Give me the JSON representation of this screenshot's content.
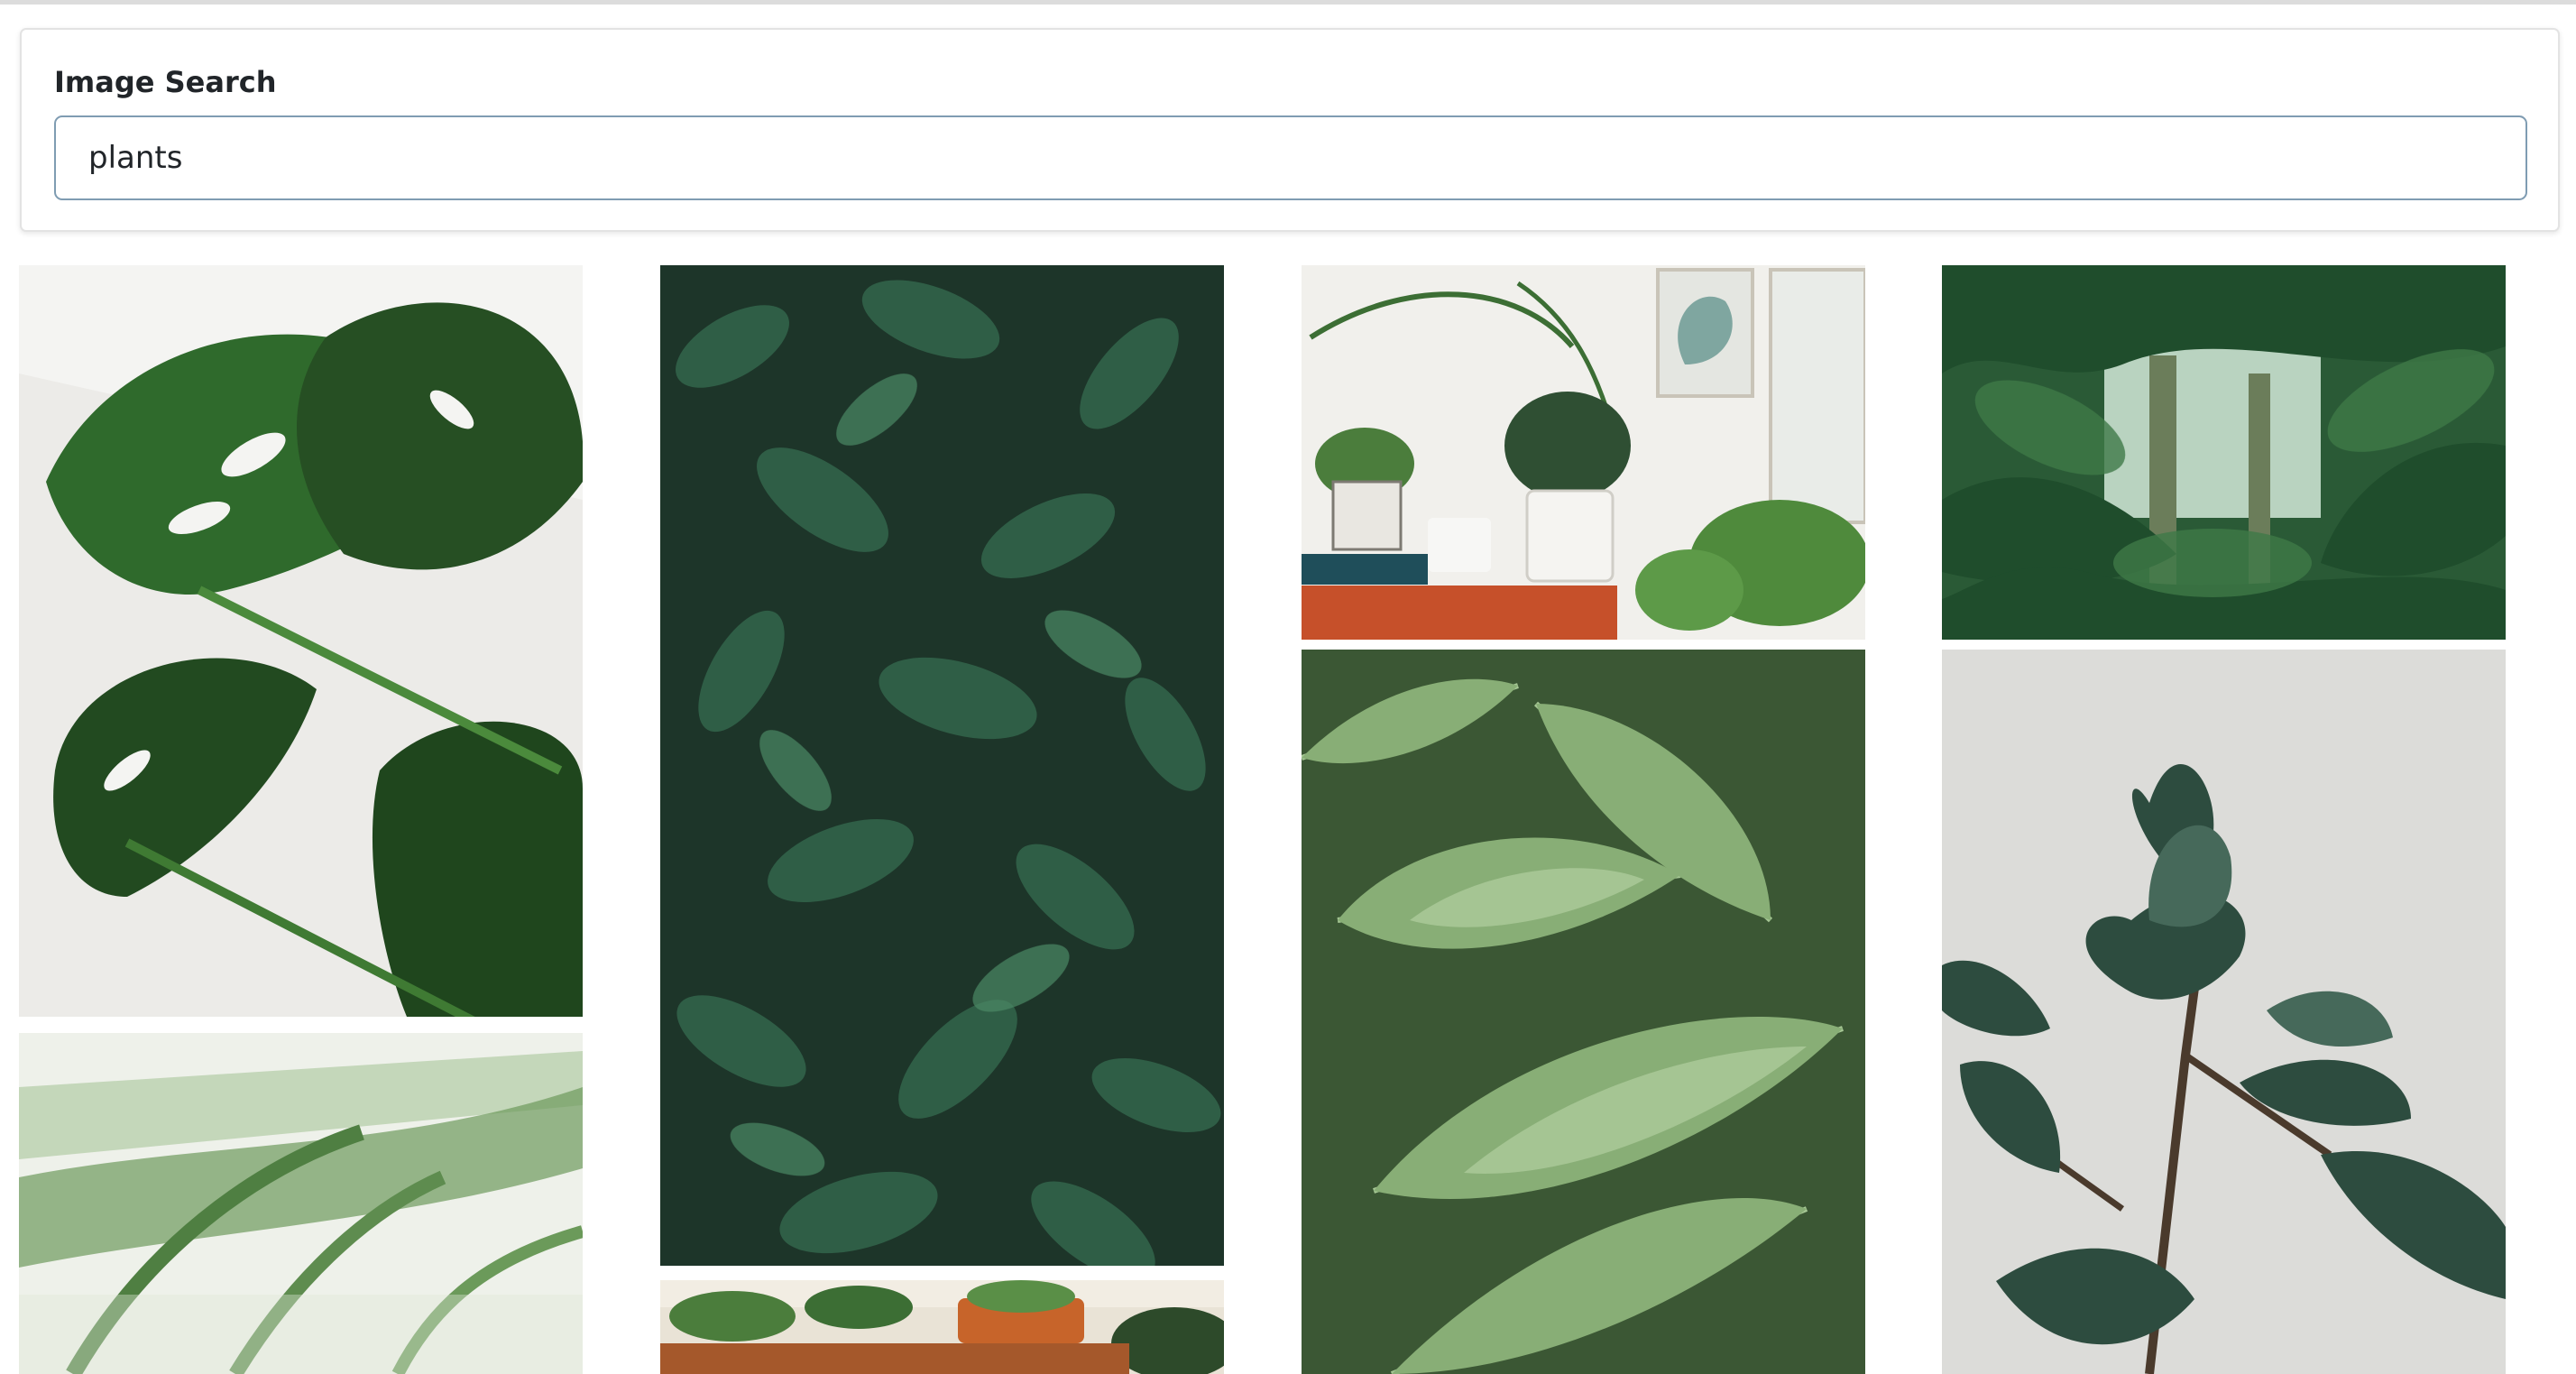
{
  "search": {
    "title": "Image Search",
    "value": "plants"
  },
  "results": {
    "images": [
      {
        "name": "monstera-leaves-white-wall",
        "colors": [
          "#f3f3f1",
          "#2f6a2c",
          "#1e4a1d"
        ]
      },
      {
        "name": "palm-fronds-blurred",
        "colors": [
          "#eef1ea",
          "#5d8d4e",
          "#8fb07a"
        ]
      },
      {
        "name": "dense-green-foliage",
        "colors": [
          "#1f3a2e",
          "#2e5c45",
          "#4c8a66"
        ]
      },
      {
        "name": "plant-shelf-pots",
        "colors": [
          "#e9e3d6",
          "#c7642a",
          "#4b7d3c"
        ]
      },
      {
        "name": "houseplants-on-shelf",
        "colors": [
          "#f1f0ec",
          "#3c6e34",
          "#c6502a"
        ]
      },
      {
        "name": "fern-fronds",
        "colors": [
          "#3f5e37",
          "#8ab07a",
          "#b8d3a3"
        ]
      },
      {
        "name": "jungle-canopy",
        "colors": [
          "#1f4d2c",
          "#39764a",
          "#a8c9b0"
        ]
      },
      {
        "name": "rubber-plant-grey-wall",
        "colors": [
          "#dcdcd9",
          "#2d4c3f",
          "#46695a"
        ]
      }
    ]
  }
}
